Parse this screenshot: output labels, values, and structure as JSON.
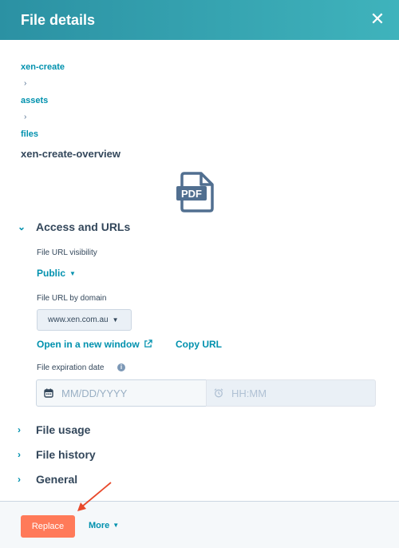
{
  "header": {
    "title": "File details",
    "close_icon": "close-icon"
  },
  "breadcrumb": {
    "items": [
      "xen-create",
      "assets",
      "files"
    ],
    "separator": "›",
    "current": "xen-create-overview"
  },
  "file": {
    "type_icon": "pdf-file-icon",
    "icon_label": "PDF"
  },
  "access_section": {
    "title": "Access and URLs",
    "expanded": true,
    "visibility_label": "File URL visibility",
    "visibility_value": "Public",
    "domain_label": "File URL by domain",
    "domain_value": "www.xen.com.au",
    "open_link": "Open in a new window",
    "copy_link": "Copy URL",
    "expiration_label": "File expiration date",
    "date_placeholder": "MM/DD/YYYY",
    "time_placeholder": "HH:MM"
  },
  "collapsed_sections": [
    "File usage",
    "File history",
    "General"
  ],
  "footer": {
    "replace_label": "Replace",
    "more_label": "More"
  },
  "colors": {
    "header_start": "#2b91a3",
    "header_end": "#3fb3bc",
    "accent": "#0091ae",
    "replace": "#ff7a59",
    "annotation_arrow": "#e8492b"
  }
}
